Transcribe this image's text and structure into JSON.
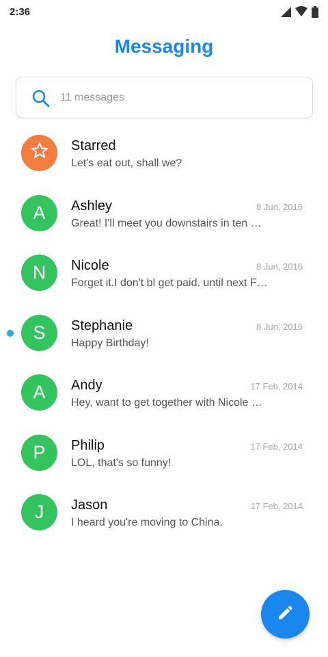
{
  "status_bar": {
    "time": "2:36",
    "icons": [
      "cellular-signal-icon",
      "wifi-icon",
      "battery-icon"
    ]
  },
  "header": {
    "title": "Messaging"
  },
  "search": {
    "placeholder": "11 messages",
    "value": ""
  },
  "colors": {
    "accent": "#1a86f0",
    "starred_avatar": "#f47c3c",
    "contact_avatar": "#34c45f",
    "unread_dot": "#2aa7f0"
  },
  "conversations": [
    {
      "name": "Starred",
      "avatar_icon": "star-icon",
      "date": "",
      "preview": "Let's eat out, shall we?",
      "unread": false
    },
    {
      "name": "Ashley",
      "initial": "A",
      "date": "8 Jun, 2016",
      "preview": "Great! I'll meet you downstairs in ten …",
      "unread": false
    },
    {
      "name": "Nicole",
      "initial": "N",
      "date": "8 Jun, 2016",
      "preview": "Forget it.I don't bl get paid. until next F…",
      "unread": false
    },
    {
      "name": "Stephanie",
      "initial": "S",
      "date": "8 Jun, 2016",
      "preview": "Happy Birthday!",
      "unread": true
    },
    {
      "name": "Andy",
      "initial": "A",
      "date": "17 Feb, 2014",
      "preview": "Hey, want to get together with Nicole …",
      "unread": false
    },
    {
      "name": "Philip",
      "initial": "P",
      "date": "17 Feb, 2014",
      "preview": "LOL, that's so funny!",
      "unread": false
    },
    {
      "name": "Jason",
      "initial": "J",
      "date": "17 Feb, 2014",
      "preview": "I heard you're moving to China.",
      "unread": false
    }
  ],
  "fab": {
    "icon": "pencil-icon"
  }
}
